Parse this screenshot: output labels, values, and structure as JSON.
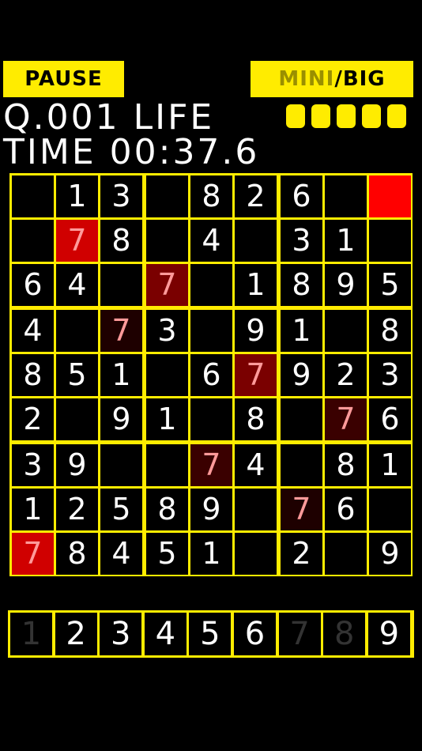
{
  "header": {
    "pause_label": "PAUSE",
    "mini_label": "MINI",
    "separator": "/",
    "big_label": "BIG",
    "question_label": "Q.001",
    "life_label": "LIFE",
    "life_remaining": 5,
    "life_total": 5,
    "time_label": "TIME",
    "time_value": "00:37.6"
  },
  "colors": {
    "accent": "#ffec00",
    "selected": "#ff0000",
    "background": "#000000"
  },
  "board": {
    "selected_cell": {
      "row": 0,
      "col": 8
    },
    "highlight_digit": "7",
    "rows": [
      [
        "",
        "1",
        "3",
        "",
        "8",
        "2",
        "6",
        "",
        ""
      ],
      [
        "",
        "7",
        "8",
        "",
        "4",
        "",
        "3",
        "1",
        ""
      ],
      [
        "6",
        "4",
        "",
        "7",
        "",
        "1",
        "8",
        "9",
        "5"
      ],
      [
        "4",
        "",
        "7",
        "3",
        "",
        "9",
        "1",
        "",
        "8"
      ],
      [
        "8",
        "5",
        "1",
        "",
        "6",
        "7",
        "9",
        "2",
        "3"
      ],
      [
        "2",
        "",
        "9",
        "1",
        "",
        "8",
        "",
        "7",
        "6"
      ],
      [
        "3",
        "9",
        "",
        "",
        "7",
        "4",
        "",
        "8",
        "1"
      ],
      [
        "1",
        "2",
        "5",
        "8",
        "9",
        "",
        "7",
        "6",
        ""
      ],
      [
        "7",
        "8",
        "4",
        "5",
        "1",
        "",
        "2",
        "",
        "9"
      ]
    ]
  },
  "numpad": {
    "keys": [
      "1",
      "2",
      "3",
      "4",
      "5",
      "6",
      "7",
      "8",
      "9"
    ],
    "completed": [
      "1",
      "7",
      "8"
    ]
  }
}
